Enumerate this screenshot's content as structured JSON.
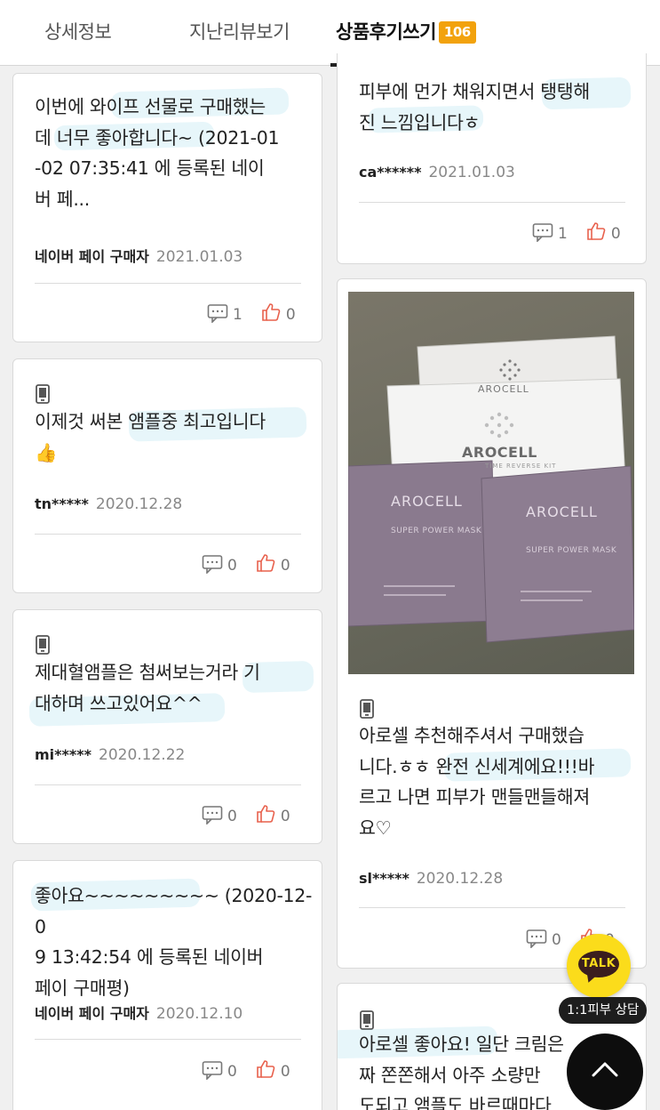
{
  "tabs": {
    "detail": "상세정보",
    "past_reviews": "지난리뷰보기",
    "write_review": "상품후기쓰기",
    "review_count": "106"
  },
  "reviews_left": [
    {
      "text_lines": [
        "이번에 와이프 선물로 구매했는",
        "데 너무 좋아합니다~ (2021-01",
        "-02 07:35:41 에 등록된 네이",
        "버 페..."
      ],
      "author": "네이버 페이 구매자",
      "date": "2021.01.03",
      "comments": "1",
      "likes": "0"
    },
    {
      "text_lines": [
        "이제것 써본 앰플중 최고입니다",
        "👍"
      ],
      "author": "tn*****",
      "date": "2020.12.28",
      "comments": "0",
      "likes": "0"
    },
    {
      "text_lines": [
        "제대혈앰플은 첨써보는거라 기",
        "대하며 쓰고있어요^^"
      ],
      "author": "mi*****",
      "date": "2020.12.22",
      "comments": "0",
      "likes": "0"
    },
    {
      "text_lines": [
        "좋아요~~~~~~~~~ (2020-12-0",
        "9 13:42:54 에 등록된 네이버",
        "페이 구매평)"
      ],
      "author": "네이버 페이 구매자",
      "date": "2020.12.10",
      "comments": "0",
      "likes": "0"
    }
  ],
  "reviews_right": [
    {
      "text_lines": [
        "피부에 먼가 채워지면서 탱탱해",
        "진 느낌입니다ㅎ"
      ],
      "author": "ca******",
      "date": "2021.01.03",
      "comments": "1",
      "likes": "0"
    },
    {
      "photo": {
        "box_brand": "AROCELL",
        "box_sub": "TIME REVERSE KIT",
        "mask_brand": "AROCELL",
        "mask_label": "SUPER POWER MASK"
      },
      "text_lines": [
        "아로셀 추천해주셔서 구매했습",
        "니다.ㅎㅎ 완전 신세계에요!!!바",
        "르고 나면 피부가 맨들맨들해져",
        "요♡"
      ],
      "author": "sl*****",
      "date": "2020.12.28",
      "comments": "0",
      "likes": "0"
    },
    {
      "text_lines": [
        "아로셀 좋아요! 일단 크림은",
        "짜 쫀쫀해서 아주 소량만",
        "도되고 앰플도 바르때마다"
      ]
    }
  ],
  "talk": {
    "label": "TALK",
    "consult_label": "1:1피부 상담"
  },
  "icons": {
    "comment": "comment-icon",
    "like": "thumbs-up-icon",
    "device": "mobile-icon",
    "scroll_top": "chevron-up-icon"
  },
  "colors": {
    "badge": "#f2a20d",
    "like_icon": "#e8604c",
    "talk_yellow": "#fbdc1b"
  }
}
